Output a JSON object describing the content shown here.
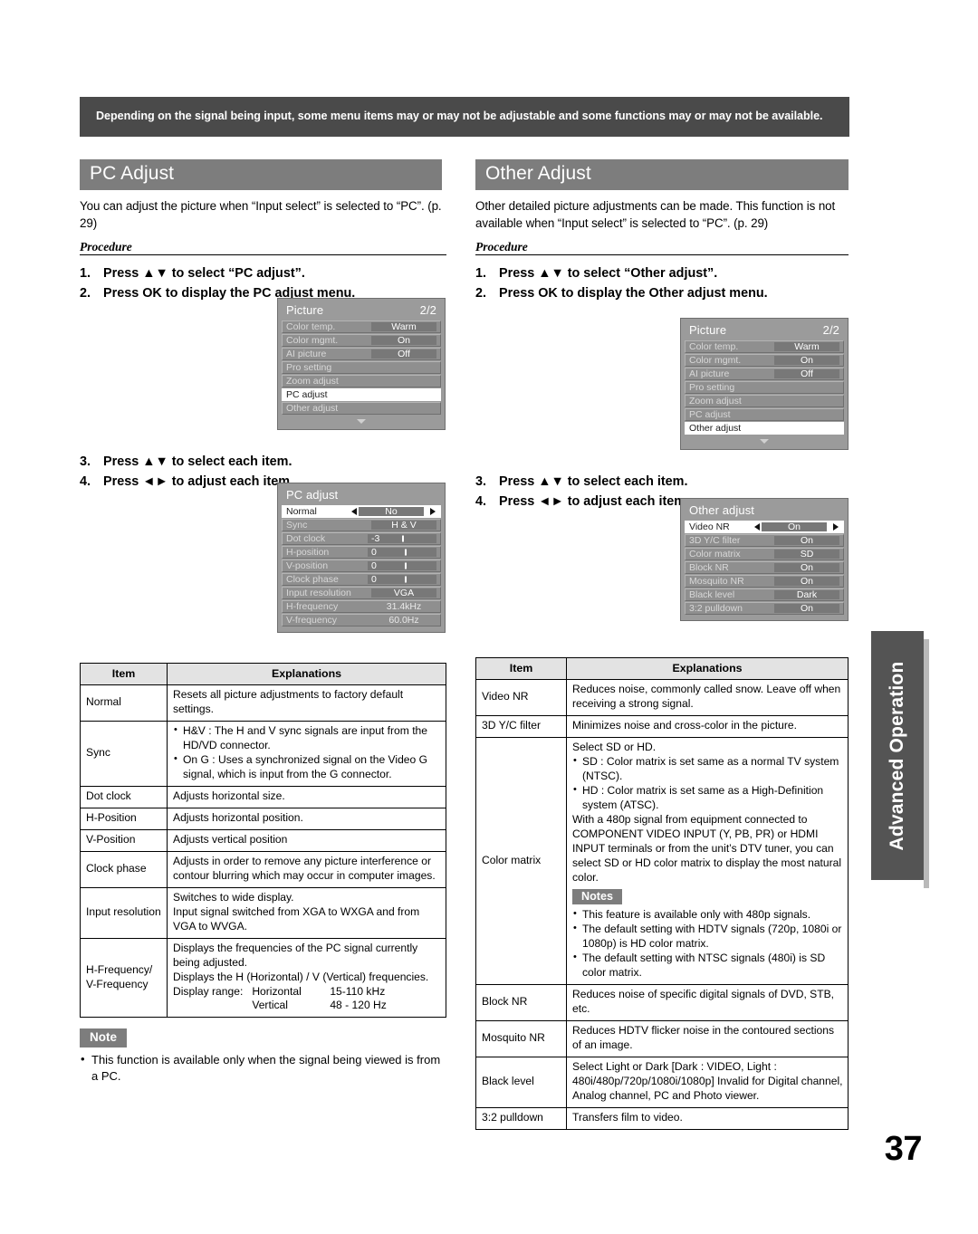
{
  "banner": {
    "text": "Depending on the signal being input, some menu items may or may not be adjustable and some functions may or may not be available."
  },
  "page_number": "37",
  "side_tab": {
    "label": "Advanced Operation"
  },
  "left": {
    "section_title": "PC Adjust",
    "intro": "You can adjust the picture when “Input select” is selected to “PC”. (p. 29)",
    "procedure_label": "Procedure",
    "steps_1_2": [
      {
        "num": "1.",
        "text": "Press ▲▼ to select “PC adjust”."
      },
      {
        "num": "2.",
        "text": "Press OK to display the PC adjust menu."
      }
    ],
    "steps_3_4": [
      {
        "num": "3.",
        "text": "Press ▲▼ to select each item."
      },
      {
        "num": "4.",
        "text": "Press ◄► to adjust each item."
      }
    ],
    "picture_menu": {
      "title": "Picture",
      "page": "2/2",
      "rows": [
        {
          "label": "Color temp.",
          "value": "Warm",
          "selected": false
        },
        {
          "label": "Color mgmt.",
          "value": "On",
          "selected": false
        },
        {
          "label": "AI picture",
          "value": "Off",
          "selected": false
        },
        {
          "label": "Pro setting",
          "value": "",
          "selected": false
        },
        {
          "label": "Zoom adjust",
          "value": "",
          "selected": false
        },
        {
          "label": "PC adjust",
          "value": "",
          "selected": true
        },
        {
          "label": "Other adjust",
          "value": "",
          "selected": false
        }
      ]
    },
    "pc_adjust_menu": {
      "title": "PC adjust",
      "rows": [
        {
          "label": "Normal",
          "value": "No",
          "selected": true,
          "slider": false
        },
        {
          "label": "Sync",
          "value": "H & V",
          "selected": false,
          "slider": false
        },
        {
          "label": "Dot clock",
          "value": "-3",
          "selected": false,
          "slider": true,
          "tick": 52
        },
        {
          "label": "H-position",
          "value": "0",
          "selected": false,
          "slider": true,
          "tick": 55
        },
        {
          "label": "V-position",
          "value": "0",
          "selected": false,
          "slider": true,
          "tick": 55
        },
        {
          "label": "Clock phase",
          "value": "0",
          "selected": false,
          "slider": true,
          "tick": 55
        },
        {
          "label": "Input resolution",
          "value": "VGA",
          "selected": false,
          "slider": false
        },
        {
          "label": "H-frequency",
          "value": "31.4kHz",
          "selected": false,
          "slider": false,
          "plain": true
        },
        {
          "label": "V-frequency",
          "value": "60.0Hz",
          "selected": false,
          "slider": false,
          "plain": true
        }
      ]
    },
    "table": {
      "headers": [
        "Item",
        "Explanations"
      ],
      "rows": [
        {
          "item": "Normal",
          "lines": [
            "Resets all picture adjustments to factory default settings."
          ]
        },
        {
          "item": "Sync",
          "bullets": [
            "H&V : The H and V sync signals are input from the HD/VD connector.",
            "On G : Uses a synchronized signal on the Video G signal, which is input from the G connector."
          ]
        },
        {
          "item": "Dot clock",
          "lines": [
            "Adjusts horizontal size."
          ]
        },
        {
          "item": "H-Position",
          "lines": [
            "Adjusts horizontal position."
          ]
        },
        {
          "item": "V-Position",
          "lines": [
            "Adjusts vertical position"
          ]
        },
        {
          "item": "Clock phase",
          "lines": [
            "Adjusts in order to remove any picture interference or contour blurring which may occur in computer images."
          ]
        },
        {
          "item": "Input resolution",
          "lines": [
            "Switches to wide display.",
            "Input signal switched from XGA to WXGA and from VGA to WVGA."
          ]
        },
        {
          "item": "H-Frequency/ V-Frequency",
          "lines": [
            "Displays the frequencies of the PC signal currently being adjusted.",
            "Displays the H (Horizontal) / V (Vertical) frequencies."
          ],
          "range_label": "Display range:",
          "range_rows": [
            {
              "axis": "Horizontal",
              "value": "15-110 kHz"
            },
            {
              "axis": "Vertical",
              "value": "48 - 120 Hz"
            }
          ]
        }
      ]
    },
    "note": {
      "badge": "Note",
      "items": [
        "This function is available only when the signal being viewed is from a PC."
      ]
    }
  },
  "right": {
    "section_title": "Other Adjust",
    "intro": "Other detailed picture adjustments can be made. This function is not available when “Input select” is selected to “PC”. (p. 29)",
    "procedure_label": "Procedure",
    "steps_1_2": [
      {
        "num": "1.",
        "text": "Press ▲▼ to select “Other adjust”."
      },
      {
        "num": "2.",
        "text": "Press OK to display the Other adjust menu."
      }
    ],
    "steps_3_4": [
      {
        "num": "3.",
        "text": "Press ▲▼ to select each item."
      },
      {
        "num": "4.",
        "text": "Press ◄► to adjust each item."
      }
    ],
    "picture_menu": {
      "title": "Picture",
      "page": "2/2",
      "rows": [
        {
          "label": "Color temp.",
          "value": "Warm",
          "selected": false
        },
        {
          "label": "Color mgmt.",
          "value": "On",
          "selected": false
        },
        {
          "label": "AI picture",
          "value": "Off",
          "selected": false
        },
        {
          "label": "Pro setting",
          "value": "",
          "selected": false
        },
        {
          "label": "Zoom adjust",
          "value": "",
          "selected": false
        },
        {
          "label": "PC adjust",
          "value": "",
          "selected": false
        },
        {
          "label": "Other adjust",
          "value": "",
          "selected": true
        }
      ]
    },
    "other_adjust_menu": {
      "title": "Other adjust",
      "rows": [
        {
          "label": "Video NR",
          "value": "On",
          "selected": true
        },
        {
          "label": "3D Y/C filter",
          "value": "On",
          "selected": false
        },
        {
          "label": "Color matrix",
          "value": "SD",
          "selected": false
        },
        {
          "label": "Block NR",
          "value": "On",
          "selected": false
        },
        {
          "label": "Mosquito NR",
          "value": "On",
          "selected": false
        },
        {
          "label": "Black level",
          "value": "Dark",
          "selected": false
        },
        {
          "label": "3:2 pulldown",
          "value": "On",
          "selected": false
        }
      ]
    },
    "table": {
      "headers": [
        "Item",
        "Explanations"
      ],
      "rows": [
        {
          "item": "Video NR",
          "lines": [
            "Reduces noise, commonly called snow. Leave off when receiving a strong signal."
          ]
        },
        {
          "item": "3D Y/C filter",
          "lines": [
            "Minimizes noise and cross-color in the picture."
          ]
        },
        {
          "item": "Color matrix",
          "lead": "Select SD or HD.",
          "bullets": [
            "SD : Color matrix is set same as a normal TV system (NTSC).",
            "HD : Color matrix is set same as a High-Definition system (ATSC)."
          ],
          "trail": "With a 480p signal from equipment connected to COMPONENT VIDEO INPUT (Y, PB, PR) or HDMI INPUT terminals or from the unit’s DTV tuner, you can select SD or HD color matrix to display the most natural color.",
          "notes_badge": "Notes",
          "notes": [
            "This feature is available only with 480p signals.",
            "The default setting with HDTV signals (720p, 1080i or 1080p) is HD color matrix.",
            "The default setting with NTSC signals (480i) is SD color matrix."
          ]
        },
        {
          "item": "Block NR",
          "lines": [
            "Reduces noise of specific digital signals of DVD, STB, etc."
          ]
        },
        {
          "item": "Mosquito NR",
          "lines": [
            "Reduces HDTV flicker noise in the contoured sections of an image."
          ]
        },
        {
          "item": "Black level",
          "lines": [
            "Select Light or Dark [Dark : VIDEO, Light : 480i/480p/720p/1080i/1080p] Invalid for Digital channel, Analog channel, PC and Photo viewer."
          ]
        },
        {
          "item": "3:2 pulldown",
          "lines": [
            "Transfers film to video."
          ]
        }
      ]
    }
  },
  "colors": {
    "banner_bg": "#4a4a4a",
    "section_bar": "#7d7d7d",
    "osd_bg": "#9b9b9b",
    "tab_bg": "#545454"
  }
}
